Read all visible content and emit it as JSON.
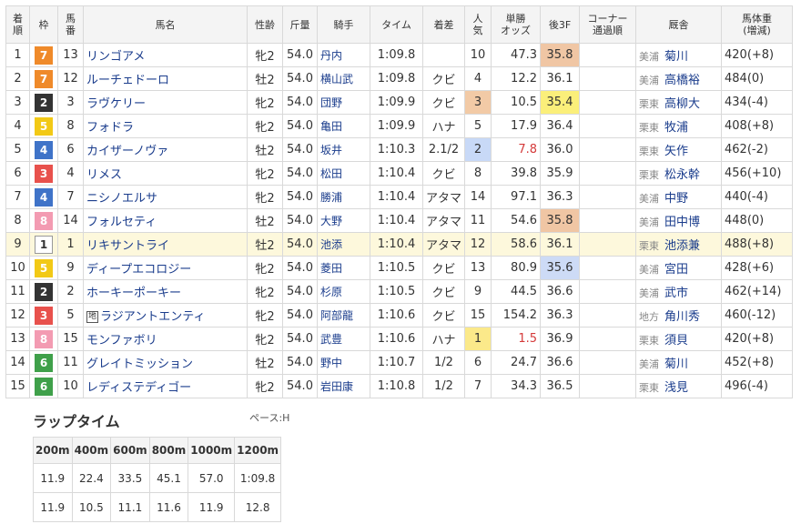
{
  "headers": [
    "着順",
    "枠",
    "馬番",
    "馬名",
    "性齢",
    "斤量",
    "騎手",
    "タイム",
    "着差",
    "人気",
    "単勝オッズ",
    "後3F",
    "コーナー通過順",
    "厩舎",
    "馬体重(増減)"
  ],
  "rows": [
    {
      "pos": "1",
      "waku": "7",
      "num": "13",
      "name": "リンゴアメ",
      "sex": "牝2",
      "weight": "54.0",
      "jockey": "丹内",
      "time": "1:09.8",
      "margin": "",
      "pop": "10",
      "odds": "47.3",
      "f3": "35.8",
      "f3rank": "1",
      "area": "美浦",
      "trainer": "菊川",
      "bw": "420(+8)"
    },
    {
      "pos": "2",
      "waku": "7",
      "num": "12",
      "name": "ルーチェドーロ",
      "sex": "牡2",
      "weight": "54.0",
      "jockey": "横山武",
      "time": "1:09.8",
      "margin": "クビ",
      "pop": "4",
      "odds": "12.2",
      "f3": "36.1",
      "f3rank": "",
      "area": "美浦",
      "trainer": "高橋裕",
      "bw": "484(0)"
    },
    {
      "pos": "3",
      "waku": "2",
      "num": "3",
      "name": "ラヴケリー",
      "sex": "牝2",
      "weight": "54.0",
      "jockey": "団野",
      "time": "1:09.9",
      "margin": "クビ",
      "pop": "3",
      "odds": "10.5",
      "f3": "35.4",
      "f3rank": "2",
      "area": "栗東",
      "trainer": "高柳大",
      "bw": "434(-4)"
    },
    {
      "pos": "4",
      "waku": "5",
      "num": "8",
      "name": "フォドラ",
      "sex": "牝2",
      "weight": "54.0",
      "jockey": "亀田",
      "time": "1:09.9",
      "margin": "ハナ",
      "pop": "5",
      "odds": "17.9",
      "f3": "36.4",
      "f3rank": "",
      "area": "栗東",
      "trainer": "牧浦",
      "bw": "408(+8)"
    },
    {
      "pos": "5",
      "waku": "4",
      "num": "6",
      "name": "カイザーノヴァ",
      "sex": "牡2",
      "weight": "54.0",
      "jockey": "坂井",
      "time": "1:10.3",
      "margin": "2.1/2",
      "pop": "2",
      "odds": "7.8",
      "f3": "36.0",
      "f3rank": "",
      "area": "栗東",
      "trainer": "矢作",
      "bw": "462(-2)"
    },
    {
      "pos": "6",
      "waku": "3",
      "num": "4",
      "name": "リメス",
      "sex": "牝2",
      "weight": "54.0",
      "jockey": "松田",
      "time": "1:10.4",
      "margin": "クビ",
      "pop": "8",
      "odds": "39.8",
      "f3": "35.9",
      "f3rank": "",
      "area": "栗東",
      "trainer": "松永幹",
      "bw": "456(+10)"
    },
    {
      "pos": "7",
      "waku": "4",
      "num": "7",
      "name": "ニシノエルサ",
      "sex": "牝2",
      "weight": "54.0",
      "jockey": "勝浦",
      "time": "1:10.4",
      "margin": "アタマ",
      "pop": "14",
      "odds": "97.1",
      "f3": "36.3",
      "f3rank": "",
      "area": "美浦",
      "trainer": "中野",
      "bw": "440(-4)"
    },
    {
      "pos": "8",
      "waku": "8",
      "num": "14",
      "name": "フォルセティ",
      "sex": "牡2",
      "weight": "54.0",
      "jockey": "大野",
      "time": "1:10.4",
      "margin": "アタマ",
      "pop": "11",
      "odds": "54.6",
      "f3": "35.8",
      "f3rank": "1",
      "area": "美浦",
      "trainer": "田中博",
      "bw": "448(0)"
    },
    {
      "pos": "9",
      "waku": "1",
      "num": "1",
      "name": "リキサントライ",
      "sex": "牡2",
      "weight": "54.0",
      "jockey": "池添",
      "time": "1:10.4",
      "margin": "アタマ",
      "pop": "12",
      "odds": "58.6",
      "f3": "36.1",
      "f3rank": "",
      "area": "栗東",
      "trainer": "池添兼",
      "bw": "488(+8)"
    },
    {
      "pos": "10",
      "waku": "5",
      "num": "9",
      "name": "ディープエコロジー",
      "sex": "牝2",
      "weight": "54.0",
      "jockey": "菱田",
      "time": "1:10.5",
      "margin": "クビ",
      "pop": "13",
      "odds": "80.9",
      "f3": "35.6",
      "f3rank": "3",
      "area": "美浦",
      "trainer": "宮田",
      "bw": "428(+6)"
    },
    {
      "pos": "11",
      "waku": "2",
      "num": "2",
      "name": "ホーキーポーキー",
      "sex": "牝2",
      "weight": "54.0",
      "jockey": "杉原",
      "time": "1:10.5",
      "margin": "クビ",
      "pop": "9",
      "odds": "44.5",
      "f3": "36.6",
      "f3rank": "",
      "area": "美浦",
      "trainer": "武市",
      "bw": "462(+14)"
    },
    {
      "pos": "12",
      "waku": "3",
      "num": "5",
      "name": "ラジアントエンティ",
      "mark": "地",
      "sex": "牝2",
      "weight": "54.0",
      "jockey": "阿部龍",
      "time": "1:10.6",
      "margin": "クビ",
      "pop": "15",
      "odds": "154.2",
      "f3": "36.3",
      "f3rank": "",
      "area": "地方",
      "trainer": "角川秀",
      "bw": "460(-12)"
    },
    {
      "pos": "13",
      "waku": "8",
      "num": "15",
      "name": "モンファボリ",
      "sex": "牝2",
      "weight": "54.0",
      "jockey": "武豊",
      "time": "1:10.6",
      "margin": "ハナ",
      "pop": "1",
      "odds": "1.5",
      "f3": "36.9",
      "f3rank": "",
      "area": "栗東",
      "trainer": "須貝",
      "bw": "420(+8)"
    },
    {
      "pos": "14",
      "waku": "6",
      "num": "11",
      "name": "グレイトミッション",
      "sex": "牡2",
      "weight": "54.0",
      "jockey": "野中",
      "time": "1:10.7",
      "margin": "1/2",
      "pop": "6",
      "odds": "24.7",
      "f3": "36.6",
      "f3rank": "",
      "area": "美浦",
      "trainer": "菊川",
      "bw": "452(+8)"
    },
    {
      "pos": "15",
      "waku": "6",
      "num": "10",
      "name": "レディステディゴー",
      "sex": "牝2",
      "weight": "54.0",
      "jockey": "岩田康",
      "time": "1:10.8",
      "margin": "1/2",
      "pop": "7",
      "odds": "34.3",
      "f3": "36.5",
      "f3rank": "",
      "area": "栗東",
      "trainer": "浅見",
      "bw": "496(-4)"
    }
  ],
  "lap": {
    "title": "ラップタイム",
    "pace": "ペース:H",
    "distances": [
      "200m",
      "400m",
      "600m",
      "800m",
      "1000m",
      "1200m"
    ],
    "cumulative": [
      "11.9",
      "22.4",
      "33.5",
      "45.1",
      "57.0",
      "1:09.8"
    ],
    "splits": [
      "11.9",
      "10.5",
      "11.1",
      "11.6",
      "11.9",
      "12.8"
    ]
  }
}
